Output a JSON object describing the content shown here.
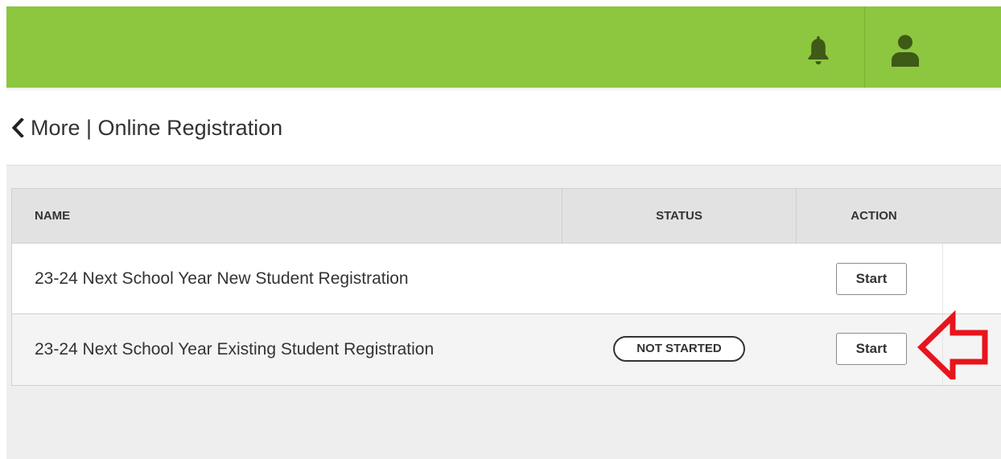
{
  "topbar": {
    "color": "#8dc63f",
    "icons": [
      "bell-icon",
      "user-icon"
    ]
  },
  "header": {
    "back_icon": "chevron-left-icon",
    "title": "More | Online Registration"
  },
  "table": {
    "columns": {
      "name": "NAME",
      "status": "STATUS",
      "action": "ACTION"
    },
    "rows": [
      {
        "name": "23-24 Next School Year New Student Registration",
        "status": "",
        "action": "Start"
      },
      {
        "name": "23-24 Next School Year Existing Student Registration",
        "status": "NOT STARTED",
        "action": "Start"
      }
    ]
  },
  "annotation": {
    "icon": "arrow-left-icon",
    "color": "#e8141c"
  }
}
